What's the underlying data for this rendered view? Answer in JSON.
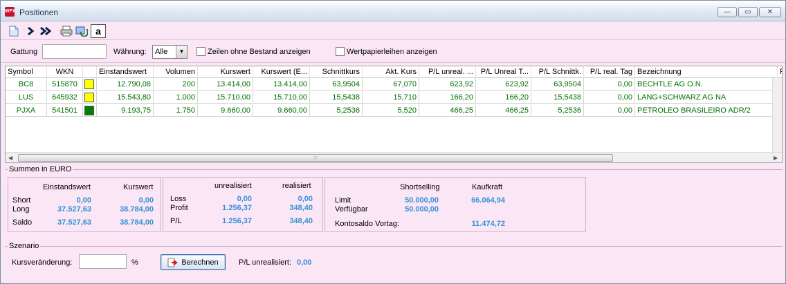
{
  "window": {
    "title": "Positionen",
    "app_icon_text": "WFX",
    "minimize": "—",
    "restore": "▭",
    "close": "✕"
  },
  "toolbar": {
    "icons": [
      "new-document-icon",
      "forward-icon",
      "fast-forward-icon",
      "print-icon",
      "refresh-icon",
      "text-toggle-icon"
    ],
    "text_toggle_label": "a"
  },
  "filters": {
    "gattung_label": "Gattung",
    "gattung_value": "",
    "waehrung_label": "Währung:",
    "waehrung_value": "Alle",
    "zeilen_label": "Zeilen ohne Bestand anzeigen",
    "wertpapier_label": "Wertpapierleihen anzeigen"
  },
  "grid": {
    "columns": [
      "Symbol",
      "WKN",
      "",
      "Einstandswert",
      "Volumen",
      "Kurswert",
      "Kurswert (E...",
      "Schnittkurs",
      "Akt. Kurs",
      "P/L unreal. ...",
      "P/L Unreal T...",
      "P/L Schnittk.",
      "P/L real. Tag",
      "Bezeichnung",
      "F"
    ],
    "rows": [
      {
        "symbol": "BC8",
        "wkn": "515870",
        "color": "#ffff00",
        "einstandswert": "12.790,08",
        "volumen": "200",
        "kurswert": "13.414,00",
        "kurswert_e": "13.414,00",
        "schnittkurs": "63,9504",
        "akt_kurs": "67,070",
        "pl_unreal": "623,92",
        "pl_unreal_t": "623,92",
        "pl_schnitt": "63,9504",
        "pl_real_tag": "0,00",
        "bezeichnung": "BECHTLE AG O.N."
      },
      {
        "symbol": "LUS",
        "wkn": "645932",
        "color": "#ffff00",
        "einstandswert": "15.543,80",
        "volumen": "1.000",
        "kurswert": "15.710,00",
        "kurswert_e": "15.710,00",
        "schnittkurs": "15,5438",
        "akt_kurs": "15,710",
        "pl_unreal": "166,20",
        "pl_unreal_t": "166,20",
        "pl_schnitt": "15,5438",
        "pl_real_tag": "0,00",
        "bezeichnung": "LANG+SCHWARZ AG NA"
      },
      {
        "symbol": "PJXA",
        "wkn": "541501",
        "color": "#008000",
        "einstandswert": "9.193,75",
        "volumen": "1.750",
        "kurswert": "9.660,00",
        "kurswert_e": "9.660,00",
        "schnittkurs": "5,2536",
        "akt_kurs": "5,520",
        "pl_unreal": "466,25",
        "pl_unreal_t": "466,25",
        "pl_schnitt": "5,2536",
        "pl_real_tag": "0,00",
        "bezeichnung": "PETROLEO BRASILEIRO ADR/2"
      }
    ],
    "hscroll_grip": ":::"
  },
  "summen": {
    "title": "Summen in EURO",
    "p1": {
      "h_einstand": "Einstandswert",
      "h_kurs": "Kurswert",
      "short": "Short",
      "short_einstand": "0,00",
      "short_kurs": "0,00",
      "long": "Long",
      "long_einstand": "37.527,63",
      "long_kurs": "38.784,00",
      "saldo": "Saldo",
      "saldo_einstand": "37.527,63",
      "saldo_kurs": "38.784,00"
    },
    "p2": {
      "h_unreal": "unrealisiert",
      "h_real": "realisiert",
      "loss": "Loss",
      "loss_unreal": "0,00",
      "loss_real": "0,00",
      "profit": "Profit",
      "profit_unreal": "1.256,37",
      "profit_real": "348,40",
      "pl": "P/L",
      "pl_unreal": "1.256,37",
      "pl_real": "348,40"
    },
    "p3": {
      "h_short": "Shortselling",
      "h_kauf": "Kaufkraft",
      "limit": "Limit",
      "limit_short": "50.000,00",
      "limit_kauf": "66.064,94",
      "verfuegbar": "Verfügbar",
      "verfuegbar_short": "50.000,00",
      "vortag": "Kontosaldo Vortag:",
      "vortag_value": "11.474,72"
    }
  },
  "szenario": {
    "title": "Szenario",
    "kurs_label": "Kursveränderung:",
    "kurs_value": "",
    "percent": "%",
    "button_label": "Berechnen",
    "pl_label": "P/L unrealisiert:",
    "pl_value": "0,00"
  },
  "colors": {
    "background": "#fae6f5",
    "row_text": "#007000",
    "value_blue": "#3391d6"
  }
}
